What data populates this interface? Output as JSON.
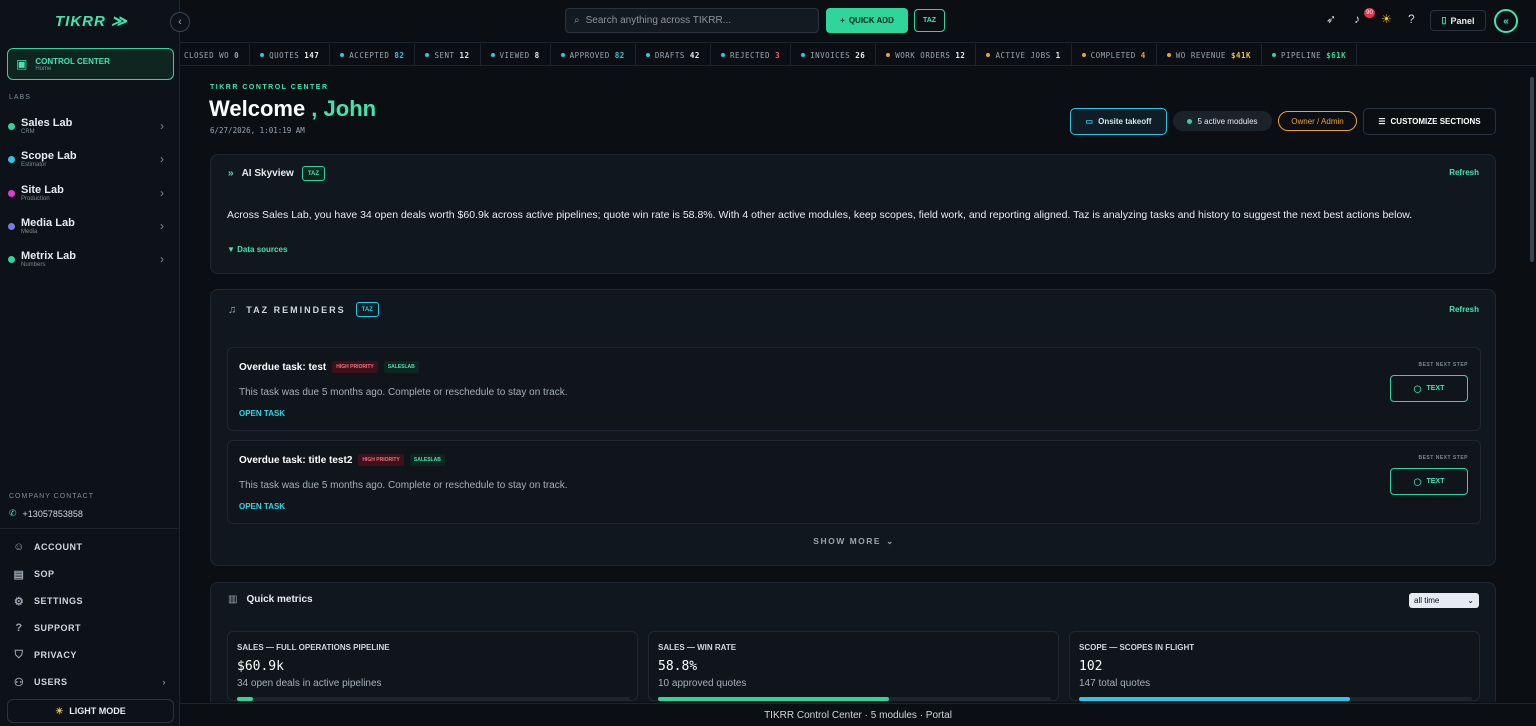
{
  "brand": {
    "logo": "TIKRR ≫",
    "accent": "#3ee6b0"
  },
  "sidebar": {
    "control_center": {
      "title": "CONTROL CENTER",
      "sub": "Home"
    },
    "labs_heading": "LABS",
    "labs": [
      {
        "name": "Sales Lab",
        "sub": "CRM",
        "color": "#2fd69c"
      },
      {
        "name": "Scope Lab",
        "sub": "Estimator",
        "color": "#2fc6e6"
      },
      {
        "name": "Site Lab",
        "sub": "Production",
        "color": "#e63ad6"
      },
      {
        "name": "Media Lab",
        "sub": "Media",
        "color": "#7a7ae6"
      },
      {
        "name": "Metrix Lab",
        "sub": "Numbers",
        "color": "#2fd69c"
      }
    ],
    "company_contact_heading": "COMPANY CONTACT",
    "company_phone": "+13057853858",
    "nav": [
      {
        "label": "ACCOUNT",
        "icon": "user-icon"
      },
      {
        "label": "SOP",
        "icon": "document-icon"
      },
      {
        "label": "SETTINGS",
        "icon": "gear-icon"
      },
      {
        "label": "SUPPORT",
        "icon": "help-icon"
      },
      {
        "label": "PRIVACY",
        "icon": "shield-icon"
      },
      {
        "label": "USERS",
        "icon": "users-icon"
      }
    ],
    "light_mode": "LIGHT MODE"
  },
  "topbar": {
    "search_placeholder": "Search anything across TIKRR...",
    "quick_add": "QUICK ADD",
    "taz": "TAZ",
    "notification_count": "90",
    "panel": "Panel"
  },
  "ticker": [
    {
      "label": "CLOSED WO",
      "value": "0",
      "color": "#9aa4ae",
      "dot": "#2fc6e6"
    },
    {
      "label": "QUOTES",
      "value": "147",
      "color": "#e6ebf0",
      "dot": "#2fc6e6"
    },
    {
      "label": "ACCEPTED",
      "value": "82",
      "color": "#2fc6e6",
      "dot": "#2fc6e6"
    },
    {
      "label": "SENT",
      "value": "12",
      "color": "#e6ebf0",
      "dot": "#2fc6e6"
    },
    {
      "label": "VIEWED",
      "value": "8",
      "color": "#e6ebf0",
      "dot": "#2fc6e6"
    },
    {
      "label": "APPROVED",
      "value": "82",
      "color": "#2fc6e6",
      "dot": "#2fc6e6"
    },
    {
      "label": "DRAFTS",
      "value": "42",
      "color": "#e6ebf0",
      "dot": "#2fc6e6"
    },
    {
      "label": "REJECTED",
      "value": "3",
      "color": "#ff5b6b",
      "dot": "#2fc6e6"
    },
    {
      "label": "INVOICES",
      "value": "26",
      "color": "#e6ebf0",
      "dot": "#2fc6e6"
    },
    {
      "label": "WORK ORDERS",
      "value": "12",
      "color": "#e6ebf0",
      "dot": "#f0a030"
    },
    {
      "label": "ACTIVE JOBS",
      "value": "1",
      "color": "#e6ebf0",
      "dot": "#f0a030"
    },
    {
      "label": "COMPLETED",
      "value": "4",
      "color": "#f0a030",
      "dot": "#f0a030"
    },
    {
      "label": "WO REVENUE",
      "value": "$41K",
      "color": "#f0c030",
      "dot": "#f0a030"
    },
    {
      "label": "PIPELINE",
      "value": "$61K",
      "color": "#2fd69c",
      "dot": "#2fd69c"
    }
  ],
  "header": {
    "eyebrow": "TIKRR CONTROL CENTER",
    "welcome": "Welcome",
    "name": "John",
    "datetime": "6/27/2026, 1:01:19 AM",
    "onsite": "Onsite takeoff",
    "modules": "5 active modules",
    "role": "Owner / Admin",
    "customize": "CUSTOMIZE SECTIONS"
  },
  "skyview": {
    "title": "AI Skyview",
    "tag": "TAZ",
    "refresh": "Refresh",
    "body": "Across Sales Lab, you have 34 open deals worth $60.9k across active pipelines; quote win rate is 58.8%. With 4 other active modules, keep scopes, field work, and reporting aligned. Taz is analyzing tasks and history to suggest the next best actions below.",
    "data_sources": "▼ Data sources"
  },
  "reminders": {
    "title": "TAZ REMINDERS",
    "tag": "TAZ",
    "refresh": "Refresh",
    "items": [
      {
        "title": "Overdue task: test",
        "priority": "HIGH PRIORITY",
        "module": "SALESLAB",
        "desc": "This task was due 5 months ago. Complete or reschedule to stay on track.",
        "open": "OPEN TASK",
        "best": "BEST NEXT STEP",
        "action": "TEXT"
      },
      {
        "title": "Overdue task: title test2",
        "priority": "HIGH PRIORITY",
        "module": "SALESLAB",
        "desc": "This task was due 5 months ago. Complete or reschedule to stay on track.",
        "open": "OPEN TASK",
        "best": "BEST NEXT STEP",
        "action": "TEXT"
      }
    ],
    "show_more": "SHOW MORE"
  },
  "metrics": {
    "title": "Quick metrics",
    "range": "all time",
    "items": [
      {
        "label": "SALES — FULL OPERATIONS PIPELINE",
        "value": "$60.9k",
        "sub": "34 open deals in active pipelines",
        "fill": 0.04,
        "color": "#2fd69c"
      },
      {
        "label": "SALES — WIN RATE",
        "value": "58.8%",
        "sub": "10 approved quotes",
        "fill": 0.588,
        "color": "#2fd69c"
      },
      {
        "label": "SCOPE — SCOPES IN FLIGHT",
        "value": "102",
        "sub": "147 total quotes",
        "fill": 0.69,
        "color": "#2fc6e6"
      }
    ]
  },
  "footer": "TIKRR Control Center · 5 modules · Portal"
}
